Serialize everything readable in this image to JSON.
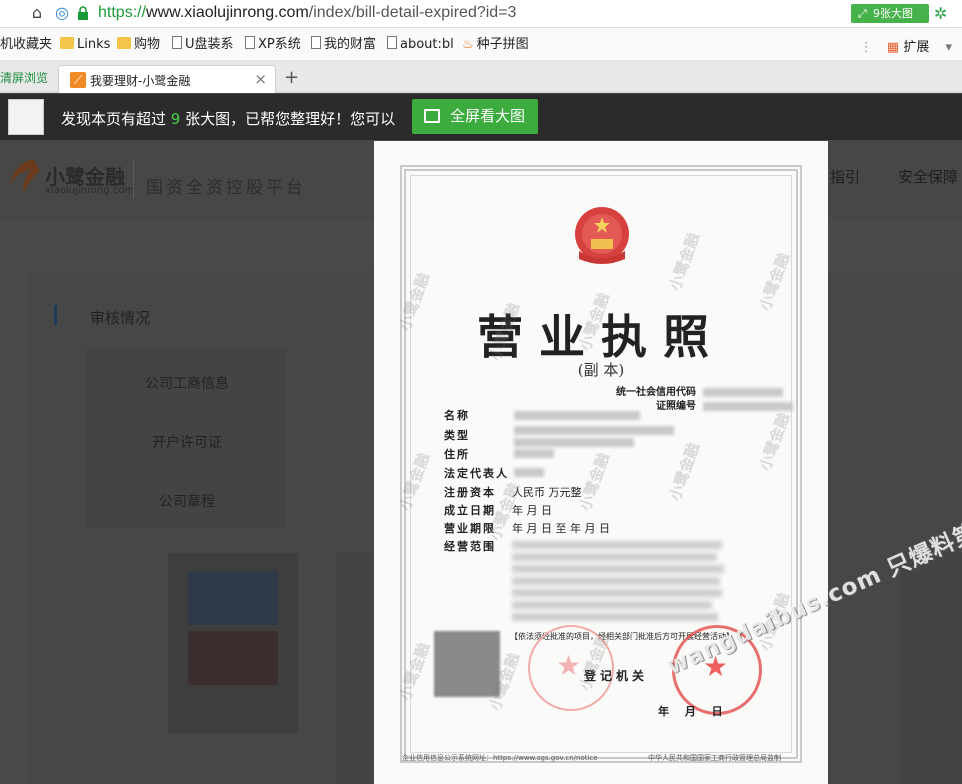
{
  "browser": {
    "url": {
      "scheme": "https://",
      "host": "www.xiaolujinrong.com",
      "path": "/index/bill-detail-expired?id=3"
    },
    "big_image_button": "9张大图",
    "bookmarks": [
      {
        "label": "机收藏夹",
        "icon": "star-icon"
      },
      {
        "label": "Links",
        "icon": "folder-icon"
      },
      {
        "label": "购物",
        "icon": "folder-icon"
      },
      {
        "label": "U盘装系",
        "icon": "page-icon"
      },
      {
        "label": "XP系统",
        "icon": "page-icon"
      },
      {
        "label": "我的财富",
        "icon": "page-icon"
      },
      {
        "label": "about:bl",
        "icon": "page-icon"
      },
      {
        "label": "种子拼图",
        "icon": "flame-icon"
      }
    ],
    "extensions_label": "扩展",
    "tabs": {
      "previous_fragment": "清屏浏览",
      "active_title": "我要理财-小鹭金融"
    }
  },
  "notice_bar": {
    "prefix": "发现本页有超过",
    "count": "9",
    "suffix": "张大图，已帮您整理好！您可以",
    "button_label": "全屏看大图"
  },
  "site": {
    "logo_name": "小鹭金融",
    "logo_domain": "xiaolujinrong.com",
    "slogan": "国资全资控股平台",
    "nav": [
      "指引",
      "安全保障"
    ],
    "section_title": "审核情况",
    "side_menu": [
      "公司工商信息",
      "开户许可证",
      "公司章程"
    ]
  },
  "certificate": {
    "title": "营业执照",
    "subtitle": "(副  本)",
    "credit_code_label": "统一社会信用代码",
    "cert_no_label": "证照编号",
    "fields": [
      {
        "label": "名称",
        "value": ""
      },
      {
        "label": "类型",
        "value": ""
      },
      {
        "label": "住所",
        "value": ""
      },
      {
        "label": "法定代表人",
        "value": ""
      },
      {
        "label": "注册资本",
        "value": "人民币        万元整"
      },
      {
        "label": "成立日期",
        "value": "      年    月    日"
      },
      {
        "label": "营业期限",
        "value": "      年    月    日 至        年    月    日"
      },
      {
        "label": "经营范围",
        "value": ""
      }
    ],
    "notice_line": "【依法须经批准的项目，经相关部门批准后方可开展经营活动】",
    "registration_org": "登记机关",
    "date": "年   月   日",
    "footer_left": "企业信用信息公示系统网址：https://www.sgs.gov.cn/notice",
    "footer_right": "中华人民共和国国家工商行政管理总局监制",
    "watermark": "小鹭金融"
  },
  "site_watermark": "wangdaibus.com 只爆料第一手网贷资讯"
}
